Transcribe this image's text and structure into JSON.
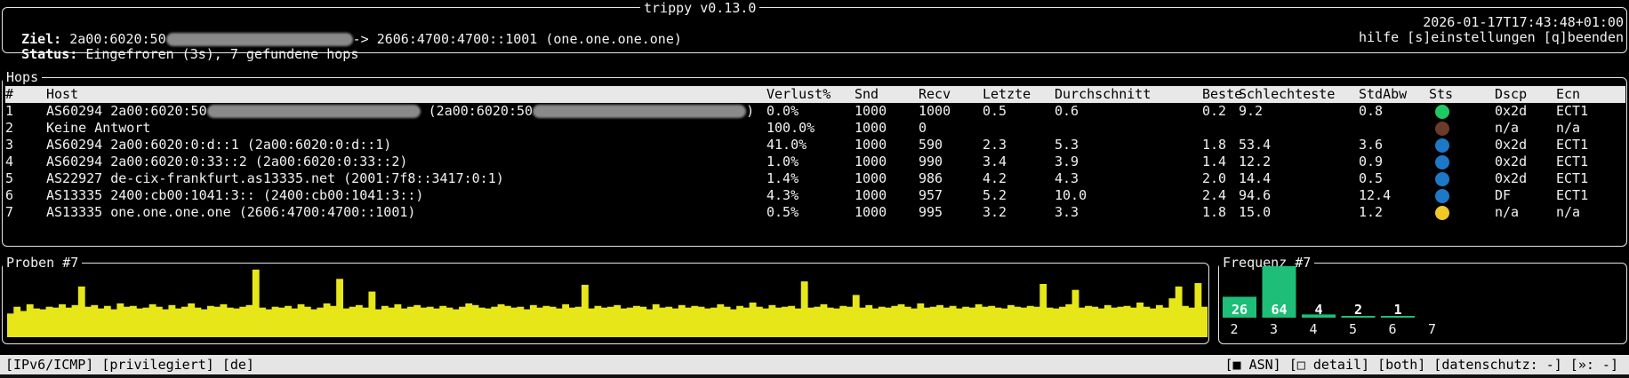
{
  "app": {
    "title": "trippy v0.13.0"
  },
  "header": {
    "target_label": "Ziel:",
    "target_src_visible": "2a00:6020:50",
    "target_arrow_dest": "-> 2606:4700:4700::1001 (one.one.one.one)",
    "timestamp": "2026-01-17T17:43:48+01:00",
    "status_label": "Status:",
    "status_text": "Eingefroren (3s), 7 gefundene hops",
    "help_text": "hilfe [s]einstellungen [q]beenden"
  },
  "hops": {
    "title": "Hops",
    "columns": [
      "#",
      "Host",
      "Verlust%",
      "Snd",
      "Recv",
      "Letzte",
      "Durchschnitt",
      "Beste",
      "Schlechteste",
      "StdAbw",
      "Sts",
      "Dscp",
      "Ecn"
    ],
    "rows": [
      {
        "n": "1",
        "host": "AS60294 2a00:6020:50",
        "host_extra": "(2a00:6020:50",
        "host_tail": ")",
        "redacted": true,
        "loss": "0.0%",
        "snd": "1000",
        "recv": "1000",
        "last": "0.5",
        "avg": "0.6",
        "best": "0.2",
        "worst": "9.2",
        "std": "0.8",
        "sts_color": "#1ec864",
        "dscp": "0x2d",
        "ecn": "ECT1"
      },
      {
        "n": "2",
        "host": "Keine Antwort",
        "loss": "100.0%",
        "snd": "1000",
        "recv": "0",
        "last": "",
        "avg": "",
        "best": "",
        "worst": "",
        "std": "",
        "sts_color": "#6b3a2a",
        "dscp": "n/a",
        "ecn": "n/a"
      },
      {
        "n": "3",
        "host": "AS60294 2a00:6020:0:d::1 (2a00:6020:0:d::1)",
        "loss": "41.0%",
        "snd": "1000",
        "recv": "590",
        "last": "2.3",
        "avg": "5.3",
        "best": "1.8",
        "worst": "53.4",
        "std": "3.6",
        "sts_color": "#1e78c8",
        "dscp": "0x2d",
        "ecn": "ECT1"
      },
      {
        "n": "4",
        "host": "AS60294 2a00:6020:0:33::2 (2a00:6020:0:33::2)",
        "loss": "1.0%",
        "snd": "1000",
        "recv": "990",
        "last": "3.4",
        "avg": "3.9",
        "best": "1.4",
        "worst": "12.2",
        "std": "0.9",
        "sts_color": "#1e78c8",
        "dscp": "0x2d",
        "ecn": "ECT1"
      },
      {
        "n": "5",
        "host": "AS22927 de-cix-frankfurt.as13335.net (2001:7f8::3417:0:1)",
        "loss": "1.4%",
        "snd": "1000",
        "recv": "986",
        "last": "4.2",
        "avg": "4.3",
        "best": "2.0",
        "worst": "14.4",
        "std": "0.5",
        "sts_color": "#1e78c8",
        "dscp": "0x2d",
        "ecn": "ECT1"
      },
      {
        "n": "6",
        "host": "AS13335 2400:cb00:1041:3:: (2400:cb00:1041:3::)",
        "loss": "4.3%",
        "snd": "1000",
        "recv": "957",
        "last": "5.2",
        "avg": "10.0",
        "best": "2.4",
        "worst": "94.6",
        "std": "12.4",
        "sts_color": "#1e78c8",
        "dscp": "DF",
        "ecn": "ECT1"
      },
      {
        "n": "7",
        "host": "AS13335 one.one.one.one (2606:4700:4700::1001)",
        "loss": "0.5%",
        "snd": "1000",
        "recv": "995",
        "last": "3.2",
        "avg": "3.3",
        "best": "1.8",
        "worst": "15.0",
        "std": "1.2",
        "sts_color": "#f0c828",
        "dscp": "n/a",
        "ecn": "n/a"
      }
    ]
  },
  "probes": {
    "title": "Proben #7",
    "color": "#e6e619",
    "values": [
      2.8,
      3.6,
      3.1,
      3.9,
      3.4,
      3.3,
      3.6,
      3.5,
      3.9,
      3.5,
      3.8,
      6.0,
      3.6,
      3.8,
      3.4,
      3.7,
      3.3,
      4.0,
      3.6,
      3.7,
      3.4,
      3.5,
      3.9,
      3.6,
      3.3,
      3.8,
      3.4,
      3.6,
      4.0,
      3.5,
      3.3,
      3.7,
      3.6,
      3.9,
      3.5,
      3.4,
      3.6,
      3.8,
      8.0,
      3.5,
      3.3,
      3.6,
      3.5,
      3.7,
      3.4,
      3.9,
      3.6,
      3.3,
      3.5,
      4.0,
      3.7,
      6.9,
      3.4,
      3.6,
      3.8,
      3.5,
      5.4,
      3.3,
      3.7,
      3.5,
      3.9,
      3.4,
      3.6,
      3.8,
      3.5,
      3.6,
      3.4,
      3.7,
      3.5,
      3.3,
      3.6,
      4.0,
      3.8,
      3.5,
      3.4,
      3.6,
      3.9,
      3.7,
      3.5,
      3.6,
      3.3,
      3.8,
      3.5,
      3.7,
      3.6,
      3.4,
      3.9,
      3.5,
      3.6,
      6.2,
      3.4,
      3.7,
      3.5,
      3.6,
      3.8,
      3.4,
      3.5,
      3.7,
      3.6,
      3.3,
      3.9,
      3.5,
      3.6,
      3.4,
      3.8,
      3.5,
      3.7,
      3.6,
      3.4,
      3.5,
      3.9,
      3.6,
      3.3,
      3.7,
      3.5,
      4.1,
      3.6,
      3.4,
      3.8,
      3.5,
      3.6,
      3.7,
      3.4,
      6.6,
      3.5,
      3.6,
      3.9,
      3.5,
      3.4,
      3.7,
      3.6,
      5.0,
      3.5,
      3.8,
      3.4,
      3.6,
      3.5,
      3.7,
      3.9,
      3.6,
      3.4,
      4.0,
      3.5,
      3.6,
      3.8,
      3.5,
      3.7,
      3.4,
      3.6,
      3.5,
      3.9,
      3.6,
      3.7,
      3.5,
      3.4,
      3.8,
      3.6,
      3.5,
      3.7,
      3.6,
      6.3,
      3.5,
      3.4,
      3.6,
      3.9,
      5.6,
      3.5,
      3.7,
      3.6,
      3.4,
      3.8,
      3.5,
      3.6,
      3.7,
      3.5,
      4.1,
      3.6,
      3.4,
      3.8,
      3.5,
      4.6,
      6.0,
      3.7,
      3.5,
      6.4,
      3.6
    ]
  },
  "frequency": {
    "title": "Frequenz #7",
    "color": "#1ebe78",
    "buckets": [
      {
        "label": "2",
        "count": "26",
        "value": 26
      },
      {
        "label": "3",
        "count": "64",
        "value": 64
      },
      {
        "label": "4",
        "count": "4",
        "value": 4
      },
      {
        "label": "5",
        "count": "2",
        "value": 2
      },
      {
        "label": "6",
        "count": "1",
        "value": 1
      },
      {
        "label": "7",
        "count": "",
        "value": 0
      }
    ]
  },
  "statusbar": {
    "left": "[IPv6/ICMP] [privilegiert] [de]",
    "right": "[■ ASN] [□ detail] [both] [datenschutz: -] [»: -]"
  }
}
